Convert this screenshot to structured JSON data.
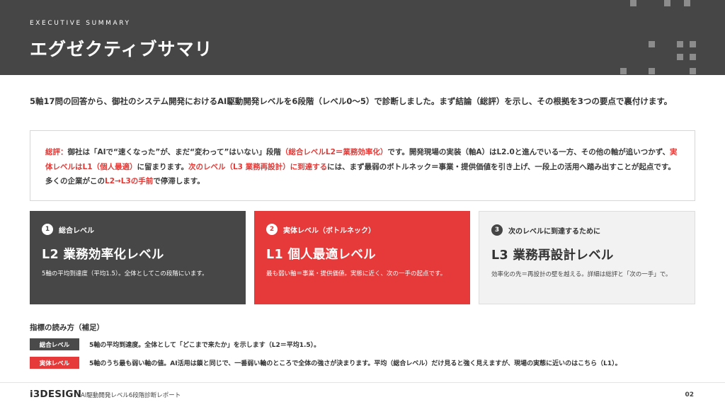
{
  "header": {
    "eyebrow": "EXECUTIVE SUMMARY",
    "title": "エグゼクティブサマリ"
  },
  "lead": "5軸17問の回答から、御社のシステム開発におけるAI駆動開発レベルを6段階（レベル0〜5）で診断しました。まず結論（総評）を示し、その根拠を3つの要点で裏付けます。",
  "summary": {
    "label": "総評：",
    "t1": "御社は「AIで“速くなった”が、まだ“変わって”はいない」段階",
    "r1": "（総合レベルL2＝業務効率化）",
    "t2": "です。開発現場の実装（軸A）はL2.0と進んでいる一方、その他の軸が追いつかず、",
    "r2": "実体レベルはL1（個人最適）",
    "t3": "に留まります。",
    "r3": "次のレベル（L3 業務再設計）に到達する",
    "t4": "には、まず最弱のボトルネック＝事業・提供価値を引き上げ、一段上の活用へ踏み出すことが起点です。多くの企業がこの",
    "r4": "L2→L3の手前",
    "t5": "で停滞します。"
  },
  "cards": [
    {
      "num": "1",
      "label": "総合レベル",
      "title": "L2 業務効率化レベル",
      "desc": "5軸の平均到達度（平均1.5）。全体としてこの段階にいます。"
    },
    {
      "num": "2",
      "label": "実体レベル（ボトルネック）",
      "title": "L1 個人最適レベル",
      "desc": "最も弱い軸＝事業・提供価値。実態に近く、次の一手の起点です。"
    },
    {
      "num": "3",
      "label": "次のレベルに到達するために",
      "title": "L3 業務再設計レベル",
      "desc": "効率化の先＝再設計の壁を越える。詳細は総評と「次の一手」で。"
    }
  ],
  "notes": {
    "title": "指標の読み方（補足）",
    "items": [
      {
        "tag": "総合レベル",
        "text": "5軸の平均到達度。全体として「どこまで来たか」を示します（L2＝平均1.5）。"
      },
      {
        "tag": "実体レベル",
        "text": "5軸のうち最も弱い軸の値。AI活用は鎖と同じで、一番弱い輪のところで全体の強さが決まります。平均（総合レベル）だけ見ると強く見えますが、現場の実態に近いのはこちら（L1）。"
      }
    ]
  },
  "footer": {
    "logo": "i3DESIGN",
    "subtitle": "AI駆動開発レベル6段階診断レポート",
    "page": "02"
  },
  "colors": {
    "dark": "#474747",
    "accent_red": "#e5393a",
    "light_card": "#f2f2f2"
  }
}
